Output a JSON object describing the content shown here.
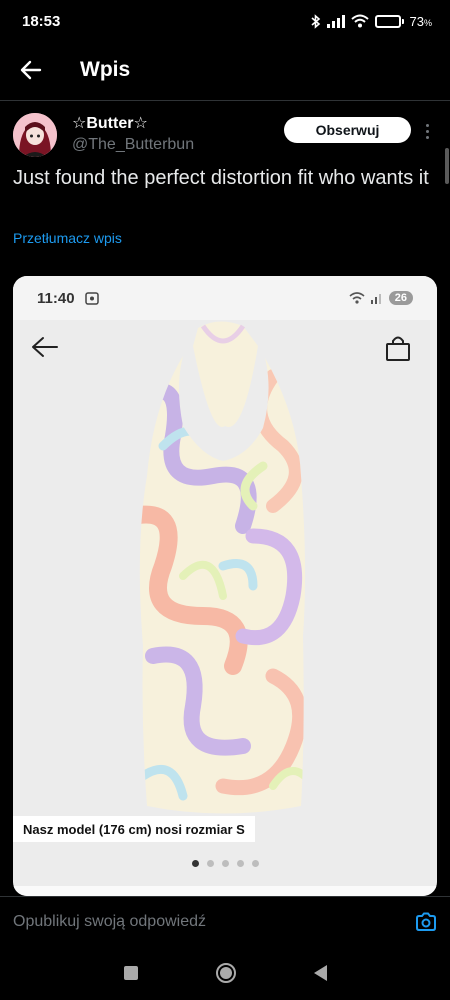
{
  "status_bar": {
    "time": "18:53",
    "battery_percent": "73",
    "battery_unit": "%",
    "battery_level": 0.73
  },
  "header": {
    "title": "Wpis",
    "back_icon": "arrow-left-icon"
  },
  "post": {
    "author_name": "☆Butter☆",
    "author_handle": "@The_Butterbun",
    "follow_label": "Obserwuj",
    "text": "Just found the perfect distortion fit who wants it",
    "translate_label": "Przetłumacz wpis"
  },
  "media": {
    "inner_time": "11:40",
    "inner_battery": "26",
    "caption": "Nasz model (176 cm) nosi rozmiar S",
    "carousel_total": 5,
    "carousel_active": 1
  },
  "reply": {
    "placeholder": "Opublikuj swoją odpowiedź",
    "camera_icon": "camera-icon"
  },
  "colors": {
    "background": "#000000",
    "accent": "#1d9bf0",
    "muted": "#71767b",
    "battery_fill": "#f5a623"
  }
}
